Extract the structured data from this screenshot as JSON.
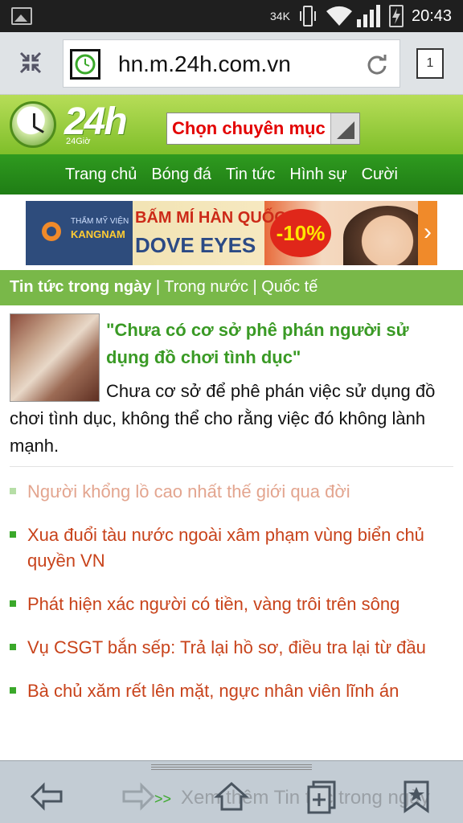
{
  "status_bar": {
    "network": "34K",
    "time": "20:43",
    "icons": [
      "image-icon",
      "phone-vibrate-icon",
      "wifi-icon",
      "signal-icon",
      "battery-charging-icon"
    ]
  },
  "browser": {
    "url": "hn.m.24h.com.vn",
    "tab_count": "1"
  },
  "site": {
    "logo_text": "24h",
    "logo_sub": "24Giờ",
    "category_select": "Chọn chuyên mục",
    "nav": [
      "Trang chủ",
      "Bóng đá",
      "Tin tức",
      "Hình sự",
      "Cười"
    ],
    "banner": {
      "brand_top": "THẨM MỸ VIỆN",
      "brand": "KANGNAM",
      "headline": "BẤM MÍ HÀN QUỐC",
      "product": "DOVE EYES",
      "discount": "-10%"
    },
    "section": {
      "active": "Tin tức trong ngày",
      "sep1": " | ",
      "link1": "Trong nước",
      "sep2": " | ",
      "link2": "Quốc tế"
    },
    "featured": {
      "title": "\"Chưa có cơ sở phê phán người sử dụng đồ chơi tình dục\"",
      "summary": "Chưa cơ sở để phê phán việc sử dụng đồ chơi tình dục, không thể cho rằng việc đó không lành mạnh."
    },
    "news": [
      "Người khổng lồ cao nhất thế giới qua đời",
      "Xua đuổi tàu nước ngoài xâm phạm vùng biển chủ quyền VN",
      "Phát hiện xác người có tiền, vàng trôi trên sông",
      "Vụ CSGT bắn sếp: Trả lại hồ sơ, điều tra lại từ đầu",
      "Bà chủ xăm rết lên mặt, ngực nhân viên lĩnh án"
    ],
    "more_arrow": ">>",
    "more_label": "Xem thêm Tin tức trong ngày"
  },
  "colors": {
    "brand_green": "#3aa82a",
    "headline_green": "#3a9a25",
    "news_orange": "#c8431b",
    "alert_red": "#e30000"
  }
}
